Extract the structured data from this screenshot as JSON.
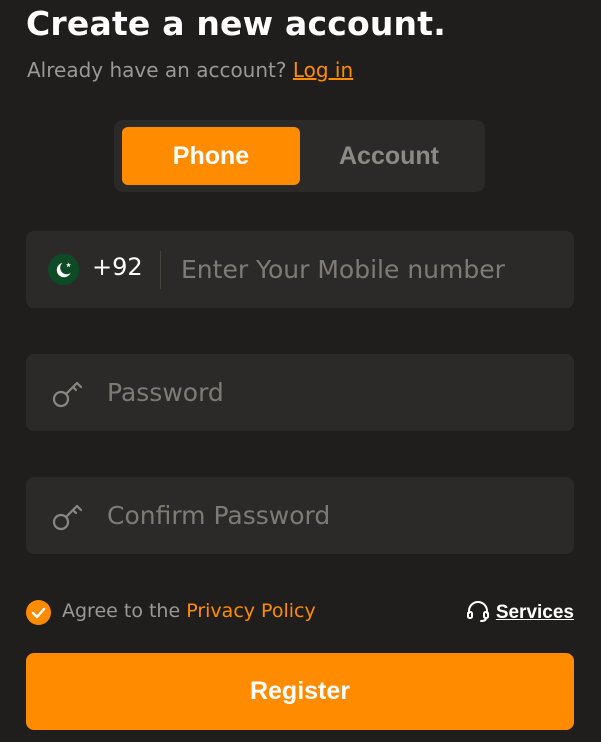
{
  "header": {
    "title": "Create a new account.",
    "subtitle_prefix": "Already have an account?",
    "login_link": "Log in"
  },
  "tabs": {
    "items": [
      {
        "label": "Phone",
        "active": true
      },
      {
        "label": "Account",
        "active": false
      }
    ]
  },
  "form": {
    "phone": {
      "flag_icon": "pakistan-flag-icon",
      "country_code": "+92",
      "placeholder": "Enter Your Mobile number",
      "value": ""
    },
    "password": {
      "icon": "key-icon",
      "placeholder": "Password",
      "value": ""
    },
    "confirm_password": {
      "icon": "key-icon",
      "placeholder": "Confirm Password",
      "value": ""
    }
  },
  "agreement": {
    "checked": true,
    "text_prefix": "Agree to the",
    "policy_link": "Privacy Policy"
  },
  "services": {
    "icon": "headset-icon",
    "label": "Services"
  },
  "register_button": {
    "label": "Register"
  },
  "colors": {
    "background": "#201e1d",
    "surface": "#2c2a28",
    "accent": "#ff8c00",
    "muted_text": "#9a9896"
  }
}
